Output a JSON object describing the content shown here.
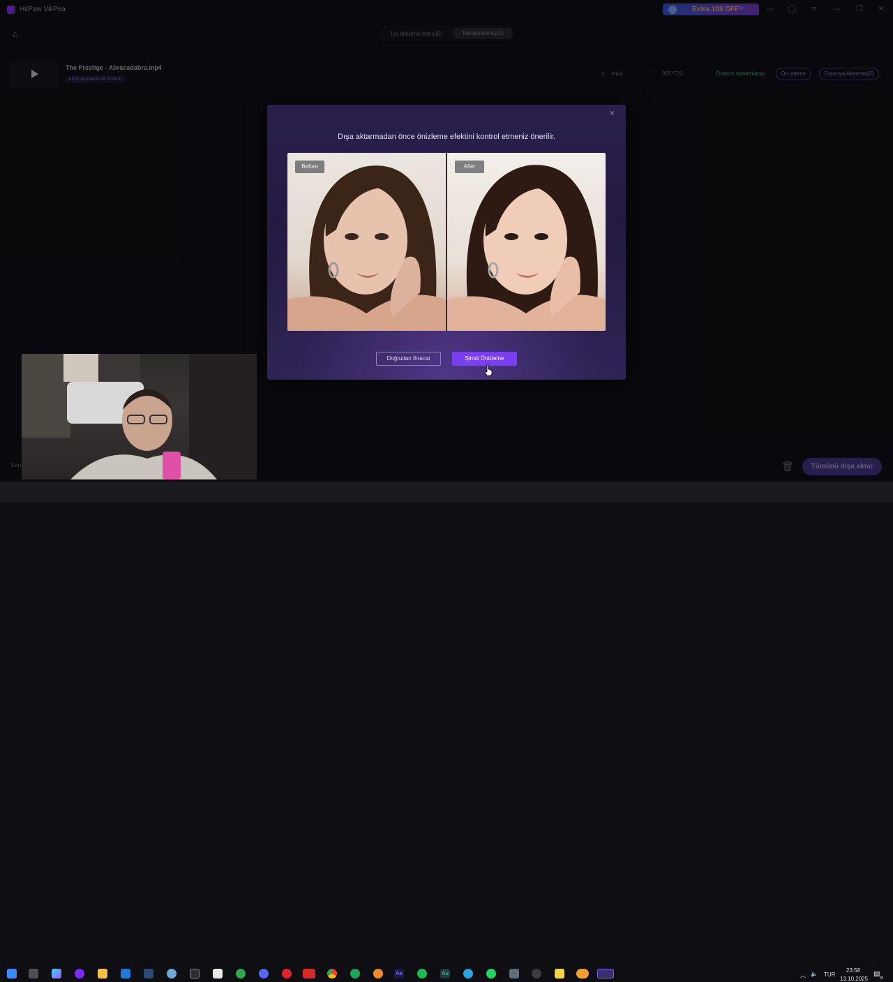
{
  "app": {
    "title": "HitPaw VikPea",
    "promo_label": "Extra 10$ OFF",
    "promo_close": "×"
  },
  "tabs": {
    "import_list": "İçe aktarma listesi(0)",
    "completed": "Tamamlanmış(1)"
  },
  "file_row": {
    "name": "The Prestige - Abracadabra.mp4",
    "tag": "Akıllı algılama ve onarım",
    "format": "mp4",
    "resolution": "960*720",
    "status": "Onarım tamamlandı",
    "preview_button": "Ön izleme",
    "export_button": "Dışarıya Aktarma(2)"
  },
  "footer": {
    "left_text": "Kon",
    "export_all_button": "Tümünü dışa aktar"
  },
  "modal": {
    "title": "Dışa aktarmadan önce önizleme efektini kontrol etmeniz önerilir.",
    "before_label": "Before",
    "after_label": "After",
    "direct_export_button": "Doğrudan İhracat",
    "preview_now_button": "Şimdi Önizleme",
    "close": "×"
  },
  "taskbar": {
    "language": "TUR",
    "time": "23:58",
    "date": "13.10.2025",
    "notification_count": "6",
    "icons": [
      "start-icon",
      "task-view-icon",
      "copilot-icon",
      "app-circle-icon",
      "file-explorer-icon",
      "outlook-icon",
      "steam-icon",
      "fingerprint-icon",
      "sc-icon",
      "store-icon",
      "xbox-icon",
      "discord-icon",
      "opera-icon",
      "voicemod-icon",
      "chrome-icon",
      "green-app-icon",
      "photos-icon",
      "after-effects-icon",
      "spotify-icon",
      "audition-icon",
      "telegram-icon",
      "whatsapp-icon",
      "calculator-icon",
      "obs-icon",
      "sticky-notes-icon",
      "cloud-icon",
      "vikpea-taskbar-icon"
    ]
  }
}
